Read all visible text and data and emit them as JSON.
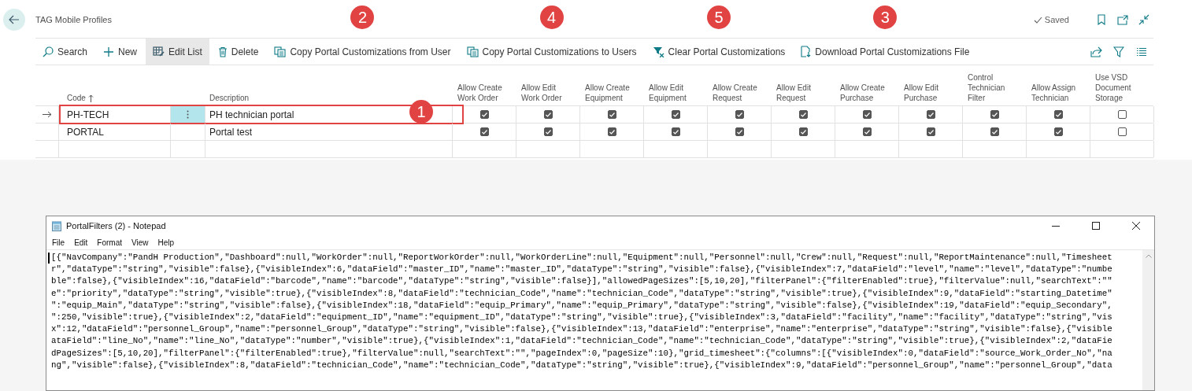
{
  "page": {
    "title": "TAG Mobile Profiles",
    "status": "Saved"
  },
  "actions": [
    {
      "label": "Search",
      "kind": "search",
      "selected": false
    },
    {
      "label": "New",
      "kind": "new",
      "selected": false
    },
    {
      "label": "Edit List",
      "kind": "edit",
      "selected": true
    },
    {
      "label": "Delete",
      "kind": "delete",
      "selected": false
    },
    {
      "label": "Copy Portal Customizations from User",
      "kind": "copy",
      "selected": false,
      "callout": "2"
    },
    {
      "label": "Copy Portal Customizations to Users",
      "kind": "copy",
      "selected": false,
      "callout": "4"
    },
    {
      "label": "Clear Portal Customizations",
      "kind": "clear",
      "selected": false,
      "callout": "5"
    },
    {
      "label": "Download Portal Customizations File",
      "kind": "download",
      "selected": false,
      "callout": "3"
    }
  ],
  "grid": {
    "columns": [
      {
        "label": "Code",
        "kind": "text",
        "sorted": true
      },
      {
        "label": "Description",
        "kind": "text",
        "sorted": false
      },
      {
        "label": "Allow Create Work Order",
        "kind": "check"
      },
      {
        "label": "Allow Edit Work Order",
        "kind": "check"
      },
      {
        "label": "Allow Create Equipment",
        "kind": "check"
      },
      {
        "label": "Allow Edit Equipment",
        "kind": "check"
      },
      {
        "label": "Allow Create Request",
        "kind": "check"
      },
      {
        "label": "Allow Edit Request",
        "kind": "check"
      },
      {
        "label": "Allow Create Purchase",
        "kind": "check"
      },
      {
        "label": "Allow Edit Purchase",
        "kind": "check"
      },
      {
        "label": "Control Technician Filter",
        "kind": "check"
      },
      {
        "label": "Allow Assign Technician",
        "kind": "check"
      },
      {
        "label": "Use VSD Document Storage",
        "kind": "check"
      }
    ],
    "rows": [
      {
        "code": "PH-TECH",
        "description": "PH technician portal",
        "selected": true,
        "highlighted": true,
        "callout": "1",
        "flags": [
          true,
          true,
          true,
          true,
          true,
          true,
          true,
          true,
          true,
          true,
          false
        ]
      },
      {
        "code": "PORTAL",
        "description": "Portal test",
        "selected": false,
        "highlighted": false,
        "flags": [
          true,
          true,
          true,
          true,
          true,
          true,
          true,
          true,
          true,
          true,
          false
        ]
      }
    ]
  },
  "notepad": {
    "title": "PortalFilters (2) - Notepad",
    "menu": [
      "File",
      "Edit",
      "Format",
      "View",
      "Help"
    ],
    "lines": [
      "[{\"NavCompany\":\"PandH Production\",\"Dashboard\":null,\"WorkOrder\":null,\"ReportWorkOrder\":null,\"WorkOrderLine\":null,\"Equipment\":null,\"Personnel\":null,\"Crew\":null,\"Request\":null,\"ReportMaintenance\":null,\"Timesheet",
      "r\",\"dataType\":\"string\",\"visible\":false},{\"visibleIndex\":6,\"dataField\":\"master_ID\",\"name\":\"master_ID\",\"dataType\":\"string\",\"visible\":false},{\"visibleIndex\":7,\"dataField\":\"level\",\"name\":\"level\",\"dataType\":\"numbe",
      "ble\":false},{\"visibleIndex\":16,\"dataField\":\"barcode\",\"name\":\"barcode\",\"dataType\":\"string\",\"visible\":false}],\"allowedPageSizes\":[5,10,20],\"filterPanel\":{\"filterEnabled\":true},\"filterValue\":null,\"searchText\":\"\"",
      "e\":\"priority\",\"dataType\":\"string\",\"visible\":true},{\"visibleIndex\":8,\"dataField\":\"technician_Code\",\"name\":\"technician_Code\",\"dataType\":\"string\",\"visible\":true},{\"visibleIndex\":9,\"dataField\":\"starting_Datetime\"",
      "\":\"equip_Main\",\"dataType\":\"string\",\"visible\":false},{\"visibleIndex\":18,\"dataField\":\"equip_Primary\",\"name\":\"equip_Primary\",\"dataType\":\"string\",\"visible\":false},{\"visibleIndex\":19,\"dataField\":\"equip_Secondary\",",
      "\":250,\"visible\":true},{\"visibleIndex\":2,\"dataField\":\"equipment_ID\",\"name\":\"equipment_ID\",\"dataType\":\"string\",\"visible\":true},{\"visibleIndex\":3,\"dataField\":\"facility\",\"name\":\"facility\",\"dataType\":\"string\",\"vis",
      "x\":12,\"dataField\":\"personnel_Group\",\"name\":\"personnel_Group\",\"dataType\":\"string\",\"visible\":false},{\"visibleIndex\":13,\"dataField\":\"enterprise\",\"name\":\"enterprise\",\"dataType\":\"string\",\"visible\":false},{\"visible",
      "ataField\":\"line_No\",\"name\":\"line_No\",\"dataType\":\"number\",\"visible\":true},{\"visibleIndex\":1,\"dataField\":\"technician_Code\",\"name\":\"technician_Code\",\"dataType\":\"string\",\"visible\":true},{\"visibleIndex\":2,\"dataFie",
      "dPageSizes\":[5,10,20],\"filterPanel\":{\"filterEnabled\":true},\"filterValue\":null,\"searchText\":\"\",\"pageIndex\":0,\"pageSize\":10},\"grid_timesheet\":{\"columns\":[{\"visibleIndex\":0,\"dataField\":\"source_Work_Order_No\",\"na",
      "ng\",\"visible\":false},{\"visibleIndex\":8,\"dataField\":\"technician_Code\",\"name\":\"technician_Code\",\"dataType\":\"string\",\"visible\":true},{\"visibleIndex\":9,\"dataField\":\"personnel_Group\",\"name\":\"personnel_Group\",\"data"
    ]
  }
}
